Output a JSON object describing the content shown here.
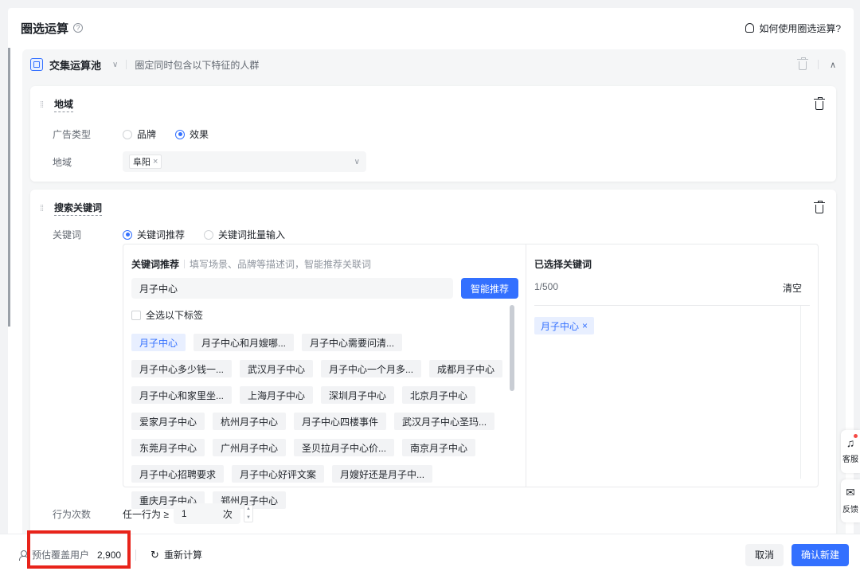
{
  "header": {
    "title": "圈选运算",
    "help_link": "如何使用圈选运算?"
  },
  "pool": {
    "name": "交集运算池",
    "description": "圈定同时包含以下特征的人群"
  },
  "region_card": {
    "title": "地域",
    "ad_type_label": "广告类型",
    "ad_type_options": [
      "品牌",
      "效果"
    ],
    "ad_type_selected": "效果",
    "region_label": "地域",
    "region_tag": "阜阳"
  },
  "keyword_card": {
    "title": "搜索关键词",
    "keyword_label": "关键词",
    "mode_options": [
      "关键词推荐",
      "关键词批量输入"
    ],
    "mode_selected": "关键词推荐",
    "recommend_title": "关键词推荐",
    "recommend_hint": "填写场景、品牌等描述词，智能推荐关联词",
    "input_value": "月子中心",
    "smart_button": "智能推荐",
    "select_all": "全选以下标签",
    "chips": [
      "月子中心",
      "月子中心和月嫂哪...",
      "月子中心需要问清...",
      "月子中心多少钱一...",
      "武汉月子中心",
      "月子中心一个月多...",
      "成都月子中心",
      "月子中心和家里坐...",
      "上海月子中心",
      "深圳月子中心",
      "北京月子中心",
      "爱家月子中心",
      "杭州月子中心",
      "月子中心四楼事件",
      "武汉月子中心圣玛...",
      "东莞月子中心",
      "广州月子中心",
      "圣贝拉月子中心价...",
      "南京月子中心",
      "月子中心招聘要求",
      "月子中心好评文案",
      "月嫂好还是月子中...",
      "重庆月子中心",
      "郑州月子中心"
    ],
    "selected_title": "已选择关键词",
    "selected_count": "1/500",
    "clear": "清空",
    "selected_chip": "月子中心",
    "freq_label": "行为次数",
    "freq_prefix": "任一行为 ≥",
    "freq_value": "1",
    "freq_unit": "次"
  },
  "footer": {
    "estimate_label": "预估覆盖用户",
    "estimate_value": "2,900",
    "recalc": "重新计算",
    "cancel": "取消",
    "confirm": "确认新建"
  },
  "float": {
    "service": "客服",
    "feedback": "反馈"
  },
  "colors": {
    "primary": "#3370ff",
    "highlight": "#e8231a"
  }
}
